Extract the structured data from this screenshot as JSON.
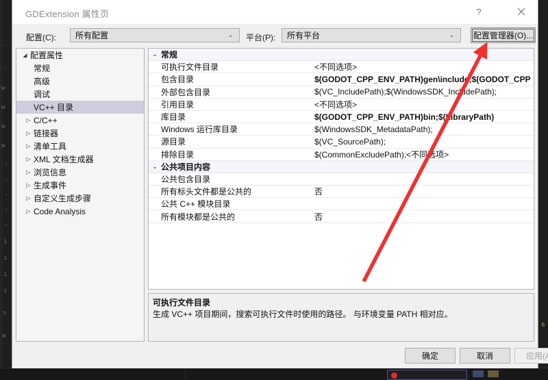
{
  "window": {
    "title": "GDExtension 属性页",
    "help_icon": "question-mark-icon",
    "help_label": "?",
    "close_icon": "close-icon",
    "close_label": "✕"
  },
  "toolbar": {
    "config_label": "配置(C):",
    "config_value": "所有配置",
    "platform_label": "平台(P):",
    "platform_value": "所有平台",
    "config_manager_label": "配置管理器(O)...",
    "chevron_icon": "chevron-down-icon",
    "chevron_glyph": "⌄"
  },
  "tree": {
    "items": [
      {
        "label": "配置属性",
        "level": 0,
        "expander": "expanded",
        "selected": false
      },
      {
        "label": "常规",
        "level": 1,
        "expander": "none",
        "selected": false
      },
      {
        "label": "高级",
        "level": 1,
        "expander": "none",
        "selected": false
      },
      {
        "label": "调试",
        "level": 1,
        "expander": "none",
        "selected": false
      },
      {
        "label": "VC++ 目录",
        "level": 1,
        "expander": "none",
        "selected": true
      },
      {
        "label": "C/C++",
        "level": 1,
        "expander": "collapsed",
        "selected": false
      },
      {
        "label": "链接器",
        "level": 1,
        "expander": "collapsed",
        "selected": false
      },
      {
        "label": "清单工具",
        "level": 1,
        "expander": "collapsed",
        "selected": false
      },
      {
        "label": "XML 文档生成器",
        "level": 1,
        "expander": "collapsed",
        "selected": false
      },
      {
        "label": "浏览信息",
        "level": 1,
        "expander": "collapsed",
        "selected": false
      },
      {
        "label": "生成事件",
        "level": 1,
        "expander": "collapsed",
        "selected": false
      },
      {
        "label": "自定义生成步骤",
        "level": 1,
        "expander": "collapsed",
        "selected": false
      },
      {
        "label": "Code Analysis",
        "level": 1,
        "expander": "collapsed",
        "selected": false
      }
    ]
  },
  "grid": {
    "rows": [
      {
        "kind": "category",
        "name": "常规",
        "value": "",
        "expander": "expanded",
        "bold_value": false
      },
      {
        "kind": "property",
        "name": "可执行文件目录",
        "value": "<不同选项>",
        "bold_value": false
      },
      {
        "kind": "property",
        "name": "包含目录",
        "value": "$(GODOT_CPP_ENV_PATH)gen\\include;$(GODOT_CPP",
        "bold_value": true
      },
      {
        "kind": "property",
        "name": "外部包含目录",
        "value": "$(VC_IncludePath);$(WindowsSDK_IncludePath);",
        "bold_value": false
      },
      {
        "kind": "property",
        "name": "引用目录",
        "value": "<不同选项>",
        "bold_value": false
      },
      {
        "kind": "property",
        "name": "库目录",
        "value": "$(GODOT_CPP_ENV_PATH)bin;$(LibraryPath)",
        "bold_value": true
      },
      {
        "kind": "property",
        "name": "Windows 运行库目录",
        "value": "$(WindowsSDK_MetadataPath);",
        "bold_value": false
      },
      {
        "kind": "property",
        "name": "源目录",
        "value": "$(VC_SourcePath);",
        "bold_value": false
      },
      {
        "kind": "property",
        "name": "排除目录",
        "value": "$(CommonExcludePath);<不同选项>",
        "bold_value": false
      },
      {
        "kind": "category",
        "name": "公共项目内容",
        "value": "",
        "expander": "expanded",
        "bold_value": false
      },
      {
        "kind": "property",
        "name": "公共包含目录",
        "value": "",
        "bold_value": false
      },
      {
        "kind": "property",
        "name": "所有标头文件都是公共的",
        "value": "否",
        "bold_value": false
      },
      {
        "kind": "property",
        "name": "公共 C++ 模块目录",
        "value": "",
        "bold_value": false
      },
      {
        "kind": "property",
        "name": "所有模块都是公共的",
        "value": "否",
        "bold_value": false
      }
    ],
    "category_expander_glyph": "⌄"
  },
  "description": {
    "title": "可执行文件目录",
    "body": "生成 VC++ 项目期间，搜索可执行文件时使用的路径。  与环境变量 PATH 相对应。"
  },
  "footer": {
    "ok_label": "确定",
    "cancel_label": "取消",
    "apply_label": "应用(A)",
    "apply_disabled": true
  },
  "annotation": {
    "arrow_color": "#f23030",
    "arrow_name": "red-pointer-arrow"
  },
  "backdrop": {
    "code_lines": [
      "w",
      "w",
      "w",
      "·",
      "·",
      "·",
      "·",
      "·",
      "i",
      "i",
      "i",
      "i",
      "s",
      "m"
    ]
  }
}
